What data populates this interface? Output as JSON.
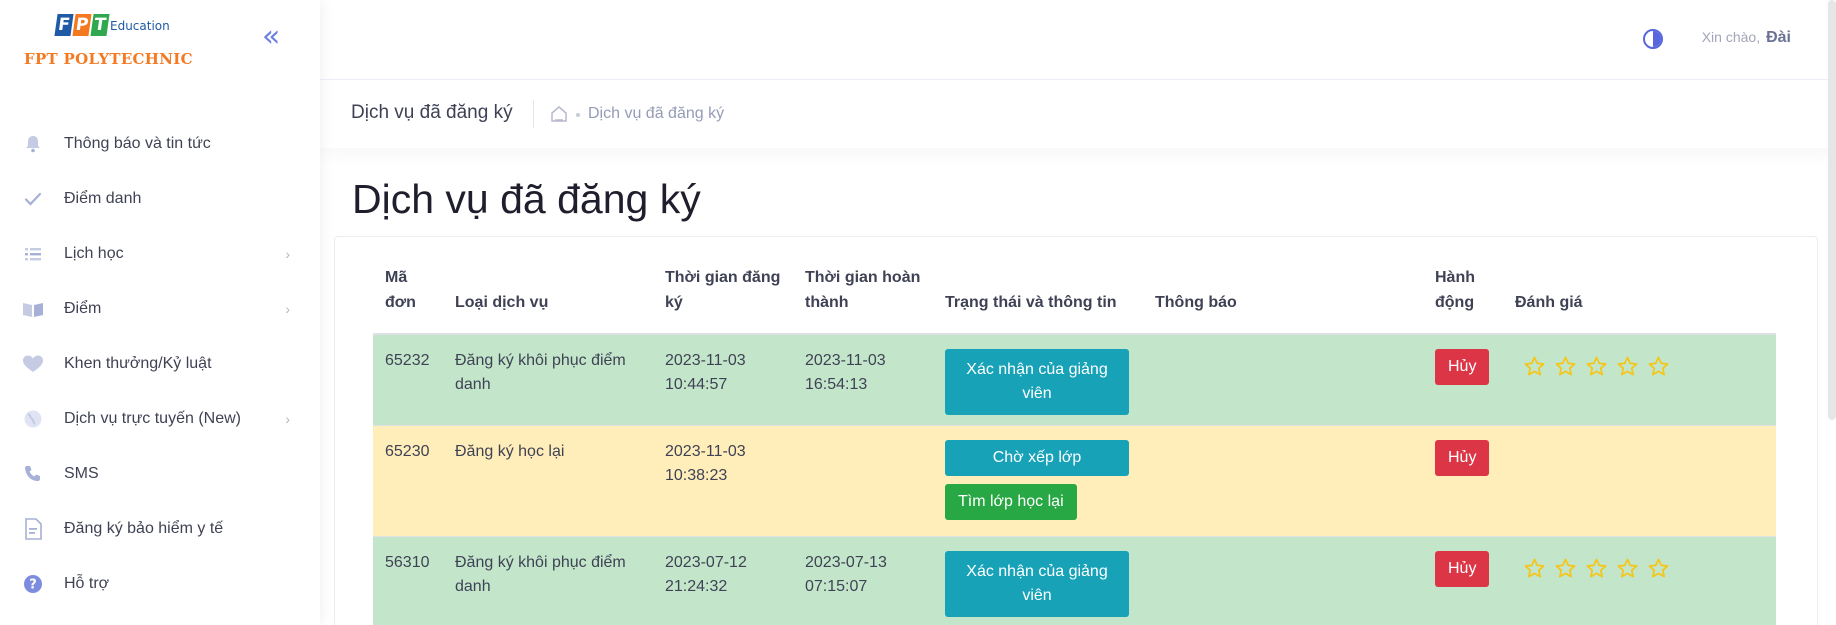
{
  "brand": {
    "fpt_letters": [
      "F",
      "P",
      "T"
    ],
    "education": "Education",
    "name": "FPT POLYTECHNIC"
  },
  "sidebar": {
    "collapse_icon": "double-chevron-left-icon",
    "items": [
      {
        "label": "Thông báo và tin tức",
        "icon": "bell-icon",
        "has_submenu": false
      },
      {
        "label": "Điểm danh",
        "icon": "check-icon",
        "has_submenu": false
      },
      {
        "label": "Lịch học",
        "icon": "list-icon",
        "has_submenu": true
      },
      {
        "label": "Điểm",
        "icon": "book-icon",
        "has_submenu": true
      },
      {
        "label": "Khen thưởng/Kỷ luật",
        "icon": "heart-icon",
        "has_submenu": false
      },
      {
        "label": "Dịch vụ trực tuyến (New)",
        "icon": "globe-icon",
        "has_submenu": true
      },
      {
        "label": "SMS",
        "icon": "phone-icon",
        "has_submenu": false
      },
      {
        "label": "Đăng ký bảo hiểm y tế",
        "icon": "document-icon",
        "has_submenu": false
      },
      {
        "label": "Hỗ trợ",
        "icon": "help-icon",
        "has_submenu": false
      }
    ]
  },
  "header": {
    "greeting": "Xin chào,",
    "username": "Đài",
    "theme_icon": "contrast-icon"
  },
  "subheader": {
    "title": "Dịch vụ đã đăng ký",
    "breadcrumb": "Dịch vụ đã đăng ký"
  },
  "page": {
    "title": "Dịch vụ đã đăng ký"
  },
  "table": {
    "headers": {
      "id": "Mã đơn",
      "type": "Loại dịch vụ",
      "registered": "Thời gian đăng ký",
      "completed": "Thời gian hoàn thành",
      "status": "Trạng thái và thông tin",
      "notice": "Thông báo",
      "action": "Hành động",
      "rating": "Đánh giá"
    },
    "rows": [
      {
        "id": "65232",
        "type": "Đăng ký khôi phục điểm danh",
        "registered": "2023-11-03 10:44:57",
        "completed": "2023-11-03 16:54:13",
        "status_button": "Xác nhận của giảng viên",
        "notice": "",
        "action": "Hủy",
        "row_color": "#c3e6cb",
        "rating_stars": 5
      },
      {
        "id": "65230",
        "type": "Đăng ký học lại",
        "registered": "2023-11-03 10:38:23",
        "completed": "",
        "status_button": "Chờ xếp lớp",
        "extra_button": "Tìm lớp học lại",
        "notice": "",
        "action": "Hủy",
        "row_color": "#ffeeba"
      },
      {
        "id": "56310",
        "type": "Đăng ký khôi phục điểm danh",
        "registered": "2023-07-12 21:24:32",
        "completed": "2023-07-13 07:15:07",
        "status_button": "Xác nhận của giảng viên",
        "notice": "",
        "action": "Hủy",
        "row_color": "#c3e6cb",
        "rating_stars": 5
      }
    ]
  },
  "colors": {
    "accent": "#5867dd",
    "info": "#17a2b8",
    "success": "#28a745",
    "danger": "#dc3545",
    "star": "#f5c518",
    "brand_orange": "#f47920"
  }
}
